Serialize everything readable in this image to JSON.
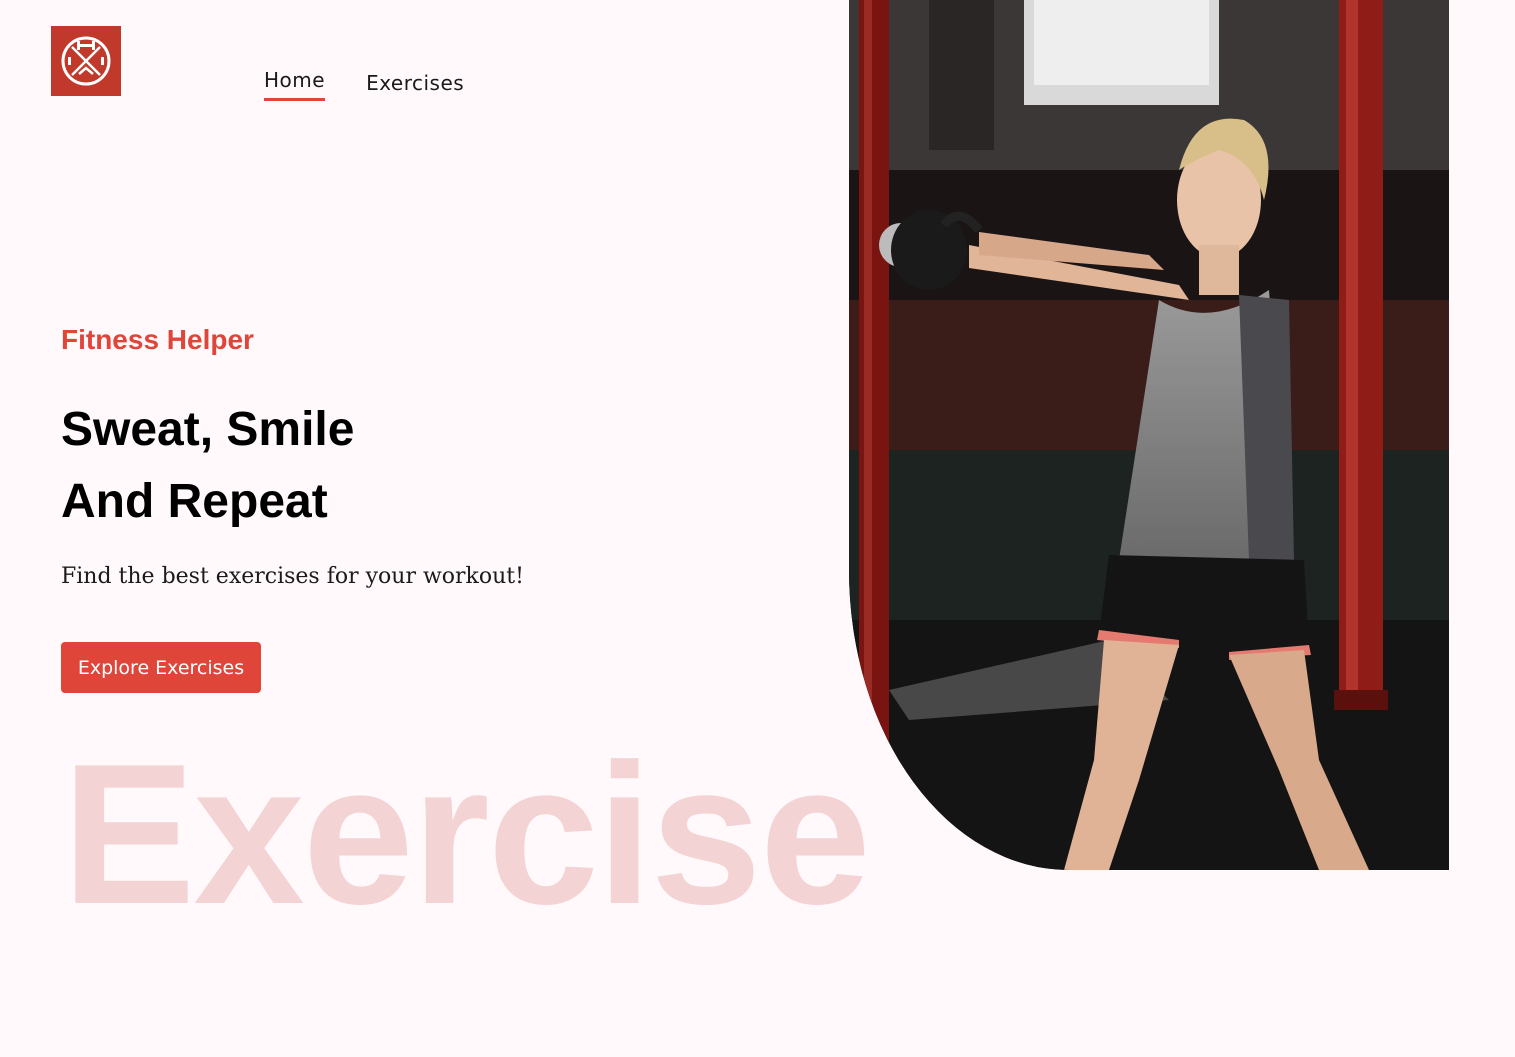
{
  "header": {
    "logo_alt": "Fitness Helper logo",
    "nav": [
      {
        "label": "Home",
        "active": true
      },
      {
        "label": "Exercises",
        "active": false
      }
    ]
  },
  "hero": {
    "brand": "Fitness Helper",
    "headline_line1": "Sweat, Smile",
    "headline_line2": "And Repeat",
    "subtitle": "Find the best exercises for your workout!",
    "cta_label": "Explore Exercises",
    "watermark": "Exercise",
    "image_subject": "woman-swinging-kettlebell-photo"
  },
  "colors": {
    "accent": "#e0453a",
    "logo_bg": "#c0392b",
    "background": "#fff9fb",
    "watermark": "#f4d3d4"
  }
}
